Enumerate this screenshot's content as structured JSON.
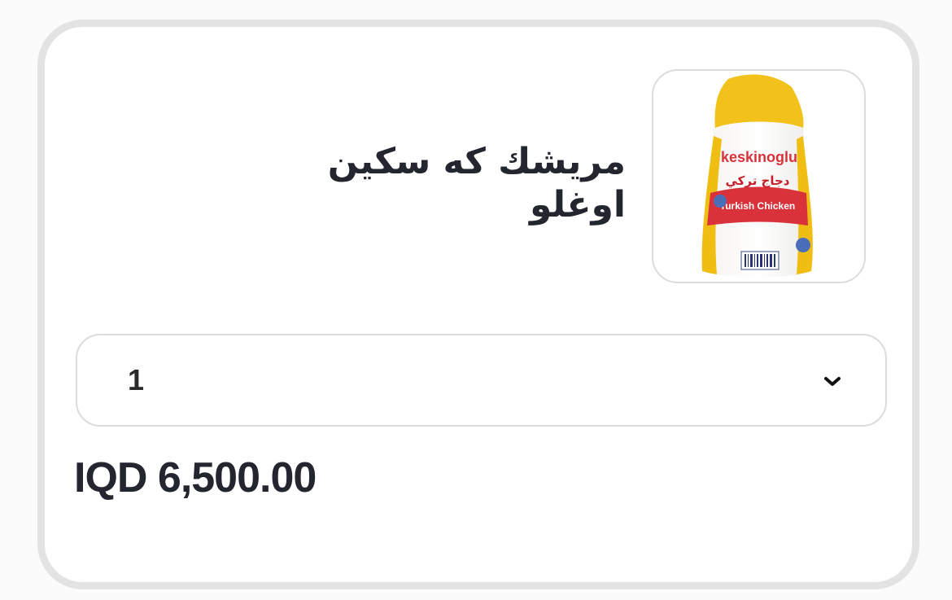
{
  "product": {
    "title": "مريشك كه سكين اوغلو",
    "image_icon": "chicken-package-icon",
    "image_brand_text": "keskinoglu",
    "image_subtitle_text": "Turkish Chicken",
    "image_arabic_text": "دجاج تركي"
  },
  "quantity": {
    "selected": "1",
    "dropdown_icon": "chevron-down-icon"
  },
  "price": {
    "label": "IQD 6,500.00"
  },
  "colors": {
    "card_border": "#e3e3e3",
    "text": "#23262e",
    "package_yellow": "#f2c21a",
    "package_red": "#d9323a"
  }
}
